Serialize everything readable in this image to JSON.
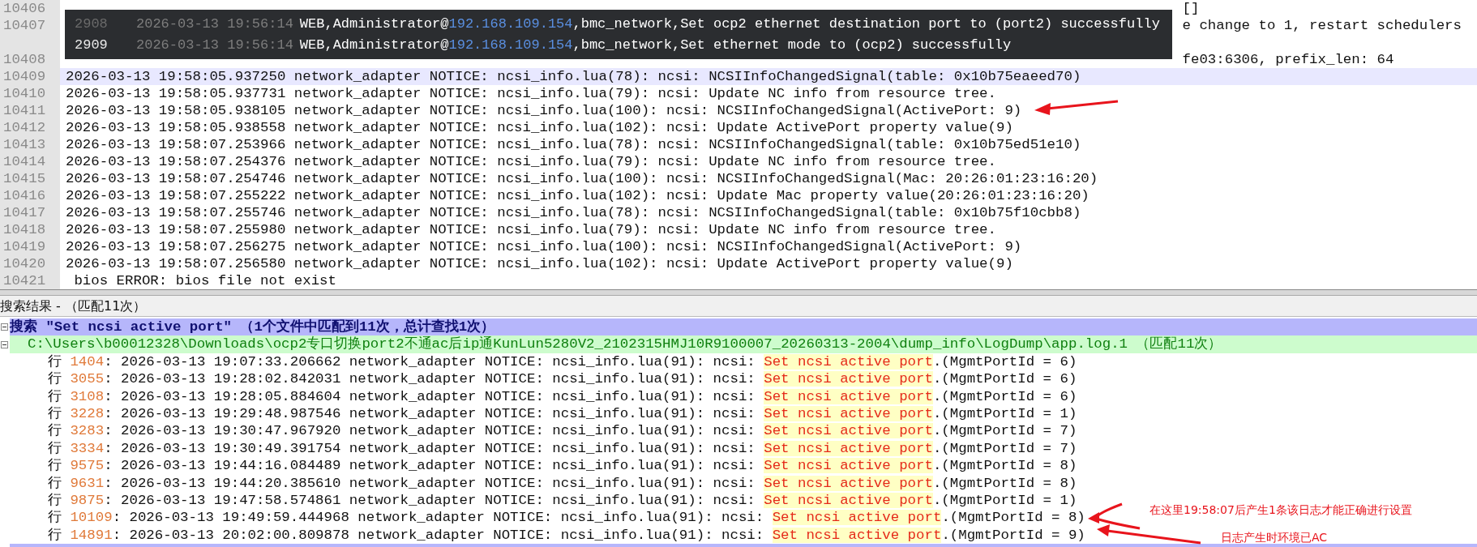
{
  "editor": {
    "lines": [
      {
        "number": "10406",
        "kind": "partial",
        "selected": false,
        "text": "[]"
      },
      {
        "number": "10407",
        "kind": "partial",
        "selected": false,
        "text": "e change to 1, restart schedulers"
      },
      {
        "number": "10408",
        "kind": "partial",
        "selected": false,
        "text": "fe03:6306, prefix_len: 64"
      },
      {
        "number": "10409",
        "kind": "line",
        "selected": true,
        "text": "2026-03-13 19:58:05.937250 network_adapter NOTICE: ncsi_info.lua(78): ncsi: NCSIInfoChangedSignal(table: 0x10b75eaeed70)"
      },
      {
        "number": "10410",
        "kind": "line",
        "selected": false,
        "text": "2026-03-13 19:58:05.937731 network_adapter NOTICE: ncsi_info.lua(79): ncsi: Update NC info from resource tree."
      },
      {
        "number": "10411",
        "kind": "line",
        "selected": false,
        "text": "2026-03-13 19:58:05.938105 network_adapter NOTICE: ncsi_info.lua(100): ncsi: NCSIInfoChangedSignal(ActivePort: 9)"
      },
      {
        "number": "10412",
        "kind": "line",
        "selected": false,
        "text": "2026-03-13 19:58:05.938558 network_adapter NOTICE: ncsi_info.lua(102): ncsi: Update ActivePort property value(9)"
      },
      {
        "number": "10413",
        "kind": "line",
        "selected": false,
        "text": "2026-03-13 19:58:07.253966 network_adapter NOTICE: ncsi_info.lua(78): ncsi: NCSIInfoChangedSignal(table: 0x10b75ed51e10)"
      },
      {
        "number": "10414",
        "kind": "line",
        "selected": false,
        "text": "2026-03-13 19:58:07.254376 network_adapter NOTICE: ncsi_info.lua(79): ncsi: Update NC info from resource tree."
      },
      {
        "number": "10415",
        "kind": "line",
        "selected": false,
        "text": "2026-03-13 19:58:07.254746 network_adapter NOTICE: ncsi_info.lua(100): ncsi: NCSIInfoChangedSignal(Mac: 20:26:01:23:16:20)"
      },
      {
        "number": "10416",
        "kind": "line",
        "selected": false,
        "text": "2026-03-13 19:58:07.255222 network_adapter NOTICE: ncsi_info.lua(102): ncsi: Update Mac property value(20:26:01:23:16:20)"
      },
      {
        "number": "10417",
        "kind": "line",
        "selected": false,
        "text": "2026-03-13 19:58:07.255746 network_adapter NOTICE: ncsi_info.lua(78): ncsi: NCSIInfoChangedSignal(table: 0x10b75f10cbb8)"
      },
      {
        "number": "10418",
        "kind": "line",
        "selected": false,
        "text": "2026-03-13 19:58:07.255980 network_adapter NOTICE: ncsi_info.lua(79): ncsi: Update NC info from resource tree."
      },
      {
        "number": "10419",
        "kind": "line",
        "selected": false,
        "text": "2026-03-13 19:58:07.256275 network_adapter NOTICE: ncsi_info.lua(100): ncsi: NCSIInfoChangedSignal(ActivePort: 9)"
      },
      {
        "number": "10420",
        "kind": "line",
        "selected": false,
        "text": "2026-03-13 19:58:07.256580 network_adapter NOTICE: ncsi_info.lua(102): ncsi: Update ActivePort property value(9)"
      },
      {
        "number": "10421",
        "kind": "line",
        "selected": false,
        "text": " bios ERROR: bios file not exist"
      }
    ]
  },
  "tooltip": {
    "rows": [
      {
        "number": "2908",
        "selected": false,
        "time": "2026-03-13 19:56:14",
        "user": "WEB,Administrator@",
        "ip": "192.168.109.154",
        "message": ",bmc_network,Set ocp2 ethernet destination port to (port2) successfully"
      },
      {
        "number": "2909",
        "selected": true,
        "time": "2026-03-13 19:56:14",
        "user": "WEB,Administrator@",
        "ip": "192.168.109.154",
        "message": ",bmc_network,Set ethernet mode to (ocp2) successfully"
      }
    ]
  },
  "search_results": {
    "title": "搜索结果 - （匹配11次）",
    "header": "搜索 \"Set ncsi active port\" （1个文件中匹配到11次，总计查找1次）",
    "file": "C:\\Users\\b00012328\\Downloads\\ocp2专口切换port2不通ac后ip通KunLun5280V2_2102315HMJ10R9100007_20260313-2004\\dump_info\\LogDump\\app.log.1 （匹配11次）",
    "rows": [
      {
        "label": "行",
        "line": "1404",
        "text": ": 2026-03-13 19:07:33.206662 network_adapter NOTICE: ncsi_info.lua(91): ncsi: ",
        "match": "Set ncsi active port",
        "rest": ".(MgmtPortId = 6)"
      },
      {
        "label": "行",
        "line": "3055",
        "text": ": 2026-03-13 19:28:02.842031 network_adapter NOTICE: ncsi_info.lua(91): ncsi: ",
        "match": "Set ncsi active port",
        "rest": ".(MgmtPortId = 6)"
      },
      {
        "label": "行",
        "line": "3108",
        "text": ": 2026-03-13 19:28:05.884604 network_adapter NOTICE: ncsi_info.lua(91): ncsi: ",
        "match": "Set ncsi active port",
        "rest": ".(MgmtPortId = 6)"
      },
      {
        "label": "行",
        "line": "3228",
        "text": ": 2026-03-13 19:29:48.987546 network_adapter NOTICE: ncsi_info.lua(91): ncsi: ",
        "match": "Set ncsi active port",
        "rest": ".(MgmtPortId = 1)"
      },
      {
        "label": "行",
        "line": "3283",
        "text": ": 2026-03-13 19:30:47.967920 network_adapter NOTICE: ncsi_info.lua(91): ncsi: ",
        "match": "Set ncsi active port",
        "rest": ".(MgmtPortId = 7)"
      },
      {
        "label": "行",
        "line": "3334",
        "text": ": 2026-03-13 19:30:49.391754 network_adapter NOTICE: ncsi_info.lua(91): ncsi: ",
        "match": "Set ncsi active port",
        "rest": ".(MgmtPortId = 7)"
      },
      {
        "label": "行",
        "line": "9575",
        "text": ": 2026-03-13 19:44:16.084489 network_adapter NOTICE: ncsi_info.lua(91): ncsi: ",
        "match": "Set ncsi active port",
        "rest": ".(MgmtPortId = 8)"
      },
      {
        "label": "行",
        "line": "9631",
        "text": ": 2026-03-13 19:44:20.385610 network_adapter NOTICE: ncsi_info.lua(91): ncsi: ",
        "match": "Set ncsi active port",
        "rest": ".(MgmtPortId = 8)"
      },
      {
        "label": "行",
        "line": "9875",
        "text": ": 2026-03-13 19:47:58.574861 network_adapter NOTICE: ncsi_info.lua(91): ncsi: ",
        "match": "Set ncsi active port",
        "rest": ".(MgmtPortId = 1)"
      },
      {
        "label": "行",
        "line": "10109",
        "text": ": 2026-03-13 19:49:59.444968 network_adapter NOTICE: ncsi_info.lua(91): ncsi: ",
        "match": "Set ncsi active port",
        "rest": ".(MgmtPortId = 8)"
      },
      {
        "label": "行",
        "line": "14891",
        "text": ": 2026-03-13 20:02:00.809878 network_adapter NOTICE: ncsi_info.lua(91): ncsi: ",
        "match": "Set ncsi active port",
        "rest": ".(MgmtPortId = 9)"
      }
    ]
  },
  "annotations": [
    "在这里19:58:07后产生1条该日志才能正确进行设置",
    "日志产生时环境已AC"
  ]
}
